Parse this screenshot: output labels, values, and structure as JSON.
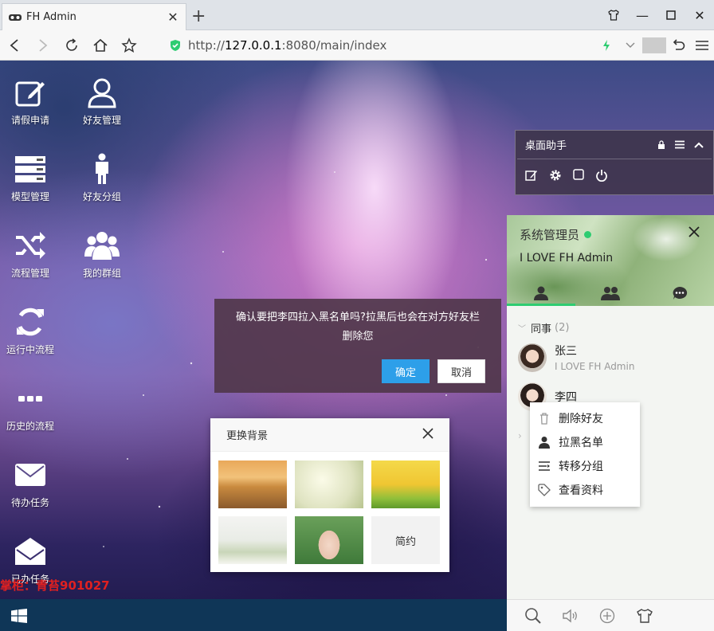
{
  "browser": {
    "tab_title": "FH Admin",
    "url_prefix": "http://",
    "url_host": "127.0.0.1",
    "url_path": ":8080/main/index"
  },
  "desktop": {
    "icons": [
      {
        "label": "请假申请",
        "icon": "edit-icon"
      },
      {
        "label": "好友管理",
        "icon": "user-icon"
      },
      {
        "label": "模型管理",
        "icon": "server-icon"
      },
      {
        "label": "好友分组",
        "icon": "person-icon"
      },
      {
        "label": "流程管理",
        "icon": "shuffle-icon"
      },
      {
        "label": "我的群组",
        "icon": "group-icon"
      },
      {
        "label": "运行中流程",
        "icon": "refresh-icon"
      },
      {
        "label": "历史的流程",
        "icon": "dots-icon"
      },
      {
        "label": "待办任务",
        "icon": "mail-icon"
      },
      {
        "label": "已办任务",
        "icon": "open-mail-icon"
      }
    ],
    "watermark": "掌柜：青苔901027"
  },
  "assistant": {
    "title": "桌面助手"
  },
  "confirm_dialog": {
    "message": "确认要把李四拉入黑名单吗?拉黑后也会在对方好友栏删除您",
    "ok_label": "确定",
    "cancel_label": "取消"
  },
  "bg_picker": {
    "title": "更换背景",
    "simple_label": "简约"
  },
  "im": {
    "username": "系统管理员",
    "signature": "I LOVE FH Admin",
    "group_name": "同事",
    "group_count": "(2)",
    "friends": [
      {
        "name": "张三",
        "sign": "I LOVE FH Admin"
      },
      {
        "name": "李四",
        "sign": ""
      }
    ]
  },
  "context_menu": {
    "items": [
      "删除好友",
      "拉黑名单",
      "转移分组",
      "查看资料"
    ]
  },
  "colors": {
    "accent_blue": "#2d9fe9",
    "online_green": "#2ecc71",
    "taskbar": "#0f3657",
    "watermark_red": "#e02020"
  }
}
